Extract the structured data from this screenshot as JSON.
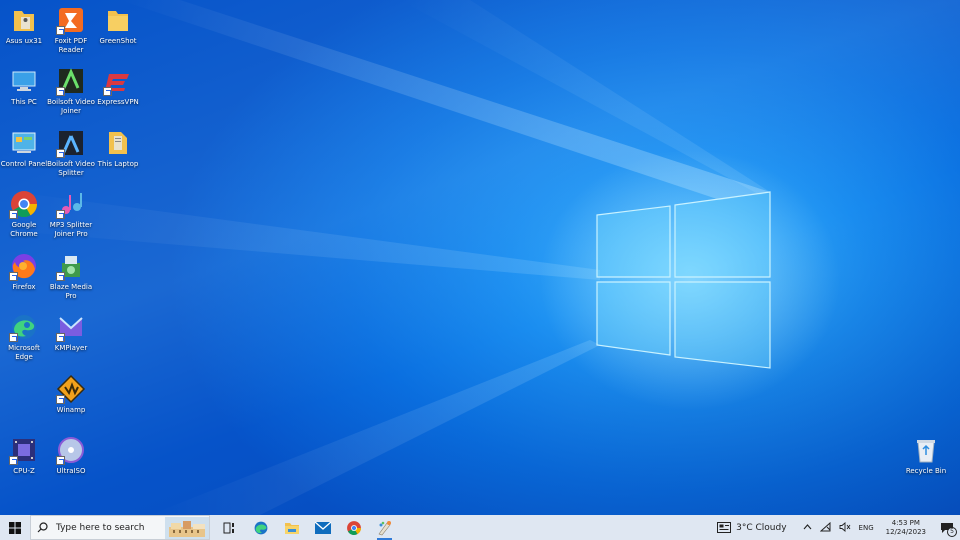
{
  "desktop": {
    "icons": {
      "asus": "Asus ux31",
      "foxit": "Foxit PDF Reader",
      "greenshot": "GreenShot",
      "this_pc": "This PC",
      "boilsoft_joiner": "Boilsoft Video Joiner",
      "expressvpn": "ExpressVPN",
      "control_panel": "Control Panel",
      "boilsoft_splitter": "Boilsoft Video Splitter",
      "this_laptop": "This Laptop",
      "chrome": "Google Chrome",
      "mp3": "MP3 Splitter Joiner Pro",
      "firefox": "Firefox",
      "blaze": "Blaze Media Pro",
      "edge": "Microsoft Edge",
      "kmplayer": "KMPlayer",
      "winamp": "Winamp",
      "cpuz": "CPU-Z",
      "ultraiso": "UltraISO",
      "recycle_bin": "Recycle Bin"
    }
  },
  "taskbar": {
    "search_placeholder": "Type here to search",
    "weather_text": "3°C  Cloudy",
    "language": "ENG",
    "time": "4:53 PM",
    "date": "12/24/2023",
    "notification_count": "5",
    "apps": [
      "task-view",
      "microsoft-edge",
      "file-explorer",
      "mail",
      "google-chrome",
      "paint"
    ]
  },
  "colors": {
    "desktop_blue": "#0a6fe0",
    "taskbar": "#dfe7f2",
    "active_indicator": "#2f7ad8"
  }
}
